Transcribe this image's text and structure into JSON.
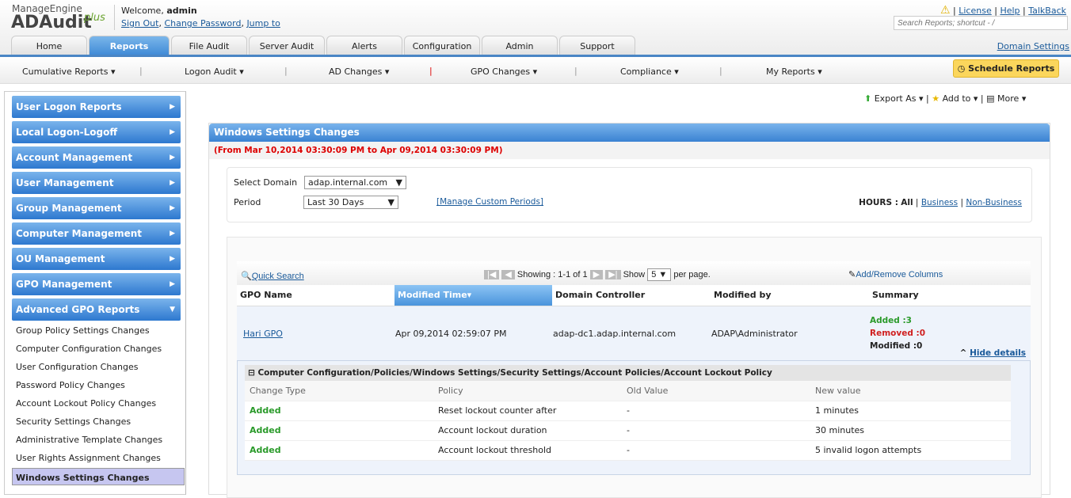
{
  "header": {
    "brand_top": "ManageEngine",
    "brand_main": "ADAudit",
    "brand_suffix": "plus",
    "welcome": "Welcome,",
    "user": "admin",
    "sign_out": "Sign Out",
    "change_password": "Change Password",
    "jump_to": "Jump to",
    "license": "License",
    "help": "Help",
    "talkback": "TalkBack",
    "search_placeholder": "Search Reports; shortcut - /",
    "domain_settings": "Domain Settings"
  },
  "tabs": [
    "Home",
    "Reports",
    "File Audit",
    "Server Audit",
    "Alerts",
    "Configuration",
    "Admin",
    "Support"
  ],
  "subnav": [
    "Cumulative Reports ▾",
    "Logon Audit ▾",
    "AD Changes ▾",
    "GPO Changes ▾",
    "Compliance ▾",
    "My Reports ▾"
  ],
  "schedule_reports": "Schedule Reports",
  "sidebar": {
    "sections": [
      "User Logon Reports",
      "Local Logon-Logoff",
      "Account Management",
      "User Management",
      "Group Management",
      "Computer Management",
      "OU Management",
      "GPO Management",
      "Advanced GPO Reports"
    ],
    "items": [
      "Group Policy Settings Changes",
      "Computer Configuration Changes",
      "User Configuration Changes",
      "Password Policy Changes",
      "Account Lockout Policy Changes",
      "Security Settings Changes",
      "Administrative Template Changes",
      "User Rights Assignment Changes",
      "Windows Settings Changes"
    ]
  },
  "toolbar": {
    "export": "Export As ▾",
    "add_to": "Add to ▾",
    "more": "More ▾"
  },
  "report": {
    "title": "Windows Settings Changes",
    "range": "(From Mar 10,2014 03:30:09 PM to Apr 09,2014 03:30:09 PM)",
    "select_domain_label": "Select Domain",
    "domain": "adap.internal.com",
    "period_label": "Period",
    "period": "Last 30 Days",
    "manage_periods": "[Manage Custom Periods]",
    "hours_label": "HOURS :",
    "hours_all": "All",
    "hours_business": "Business",
    "hours_non": "Non-Business"
  },
  "grid": {
    "quick_search": "Quick Search",
    "showing": "Showing :",
    "range": "1-1 of 1",
    "show": "Show",
    "per_page_value": "5",
    "per_page": "per page.",
    "add_remove": "Add/Remove Columns",
    "columns": [
      "GPO Name",
      "Modified Time▾",
      "Domain Controller",
      "Modified by",
      "Summary"
    ],
    "row": {
      "gpo": "Hari GPO",
      "time": "Apr 09,2014 02:59:07 PM",
      "dc": "adap-dc1.adap.internal.com",
      "by": "ADAP\\Administrator",
      "added": "Added :3",
      "removed": "Removed :0",
      "modified": "Modified :0",
      "hide": "Hide details"
    },
    "detail_path": "Computer Configuration/Policies/Windows Settings/Security Settings/Account Policies/Account Lockout Policy",
    "detail_columns": [
      "Change Type",
      "Policy",
      "Old Value",
      "New value"
    ],
    "detail_rows": [
      [
        "Added",
        "Reset lockout counter after",
        "-",
        "1 minutes"
      ],
      [
        "Added",
        "Account lockout duration",
        "-",
        "30 minutes"
      ],
      [
        "Added",
        "Account lockout threshold",
        "-",
        "5 invalid logon attempts"
      ]
    ]
  }
}
